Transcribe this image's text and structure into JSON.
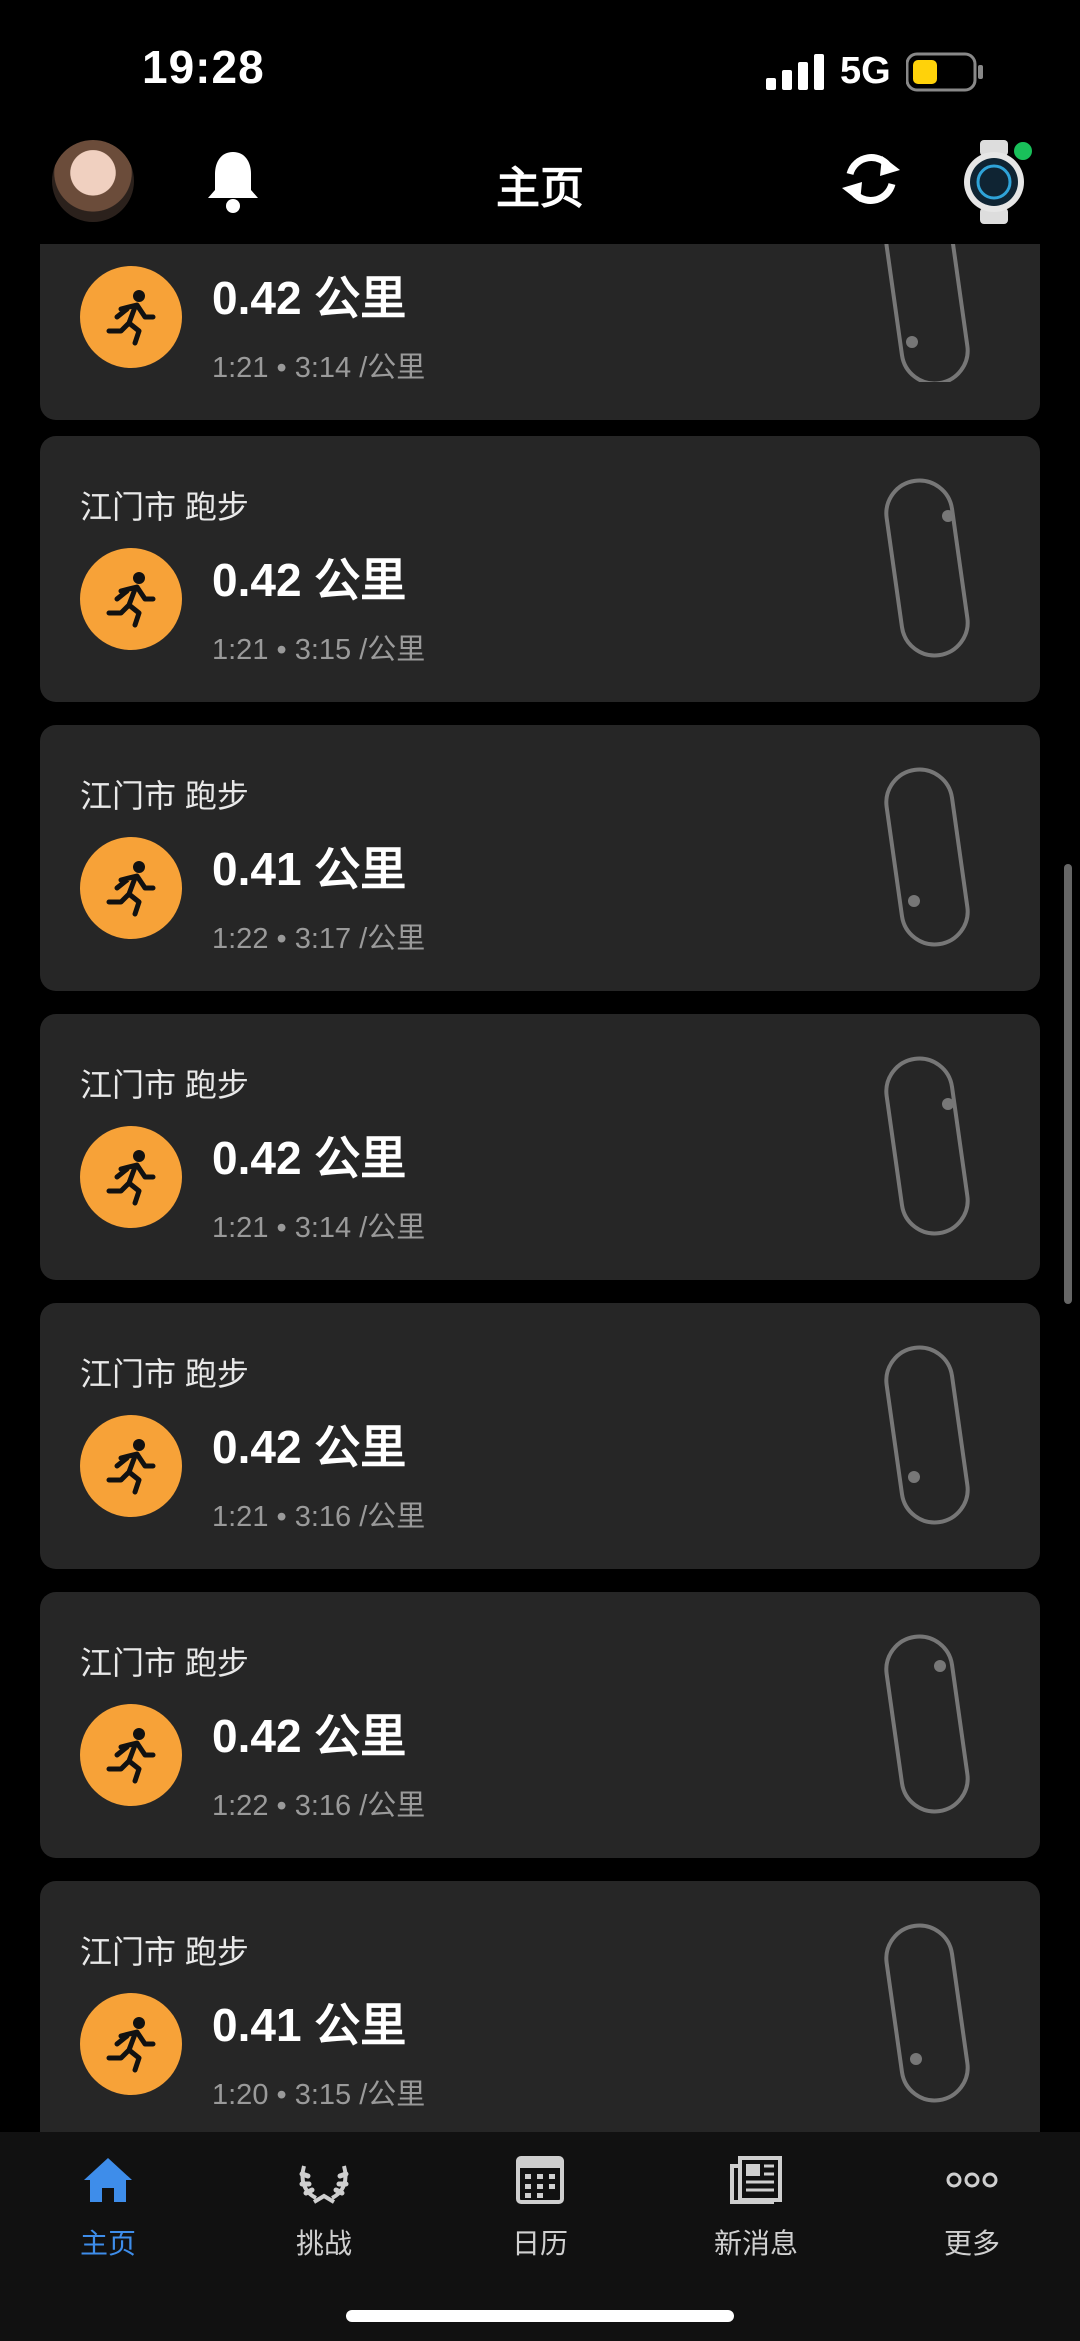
{
  "status": {
    "time": "19:28",
    "network": "5G"
  },
  "header": {
    "title": "主页"
  },
  "activities": [
    {
      "location": "",
      "distance": "0.42 公里",
      "time": "1:21",
      "pace": "3:14 /公里"
    },
    {
      "location": "江门市 跑步",
      "distance": "0.42 公里",
      "time": "1:21",
      "pace": "3:15 /公里"
    },
    {
      "location": "江门市 跑步",
      "distance": "0.41 公里",
      "time": "1:22",
      "pace": "3:17 /公里"
    },
    {
      "location": "江门市 跑步",
      "distance": "0.42 公里",
      "time": "1:21",
      "pace": "3:14 /公里"
    },
    {
      "location": "江门市 跑步",
      "distance": "0.42 公里",
      "time": "1:21",
      "pace": "3:16 /公里"
    },
    {
      "location": "江门市 跑步",
      "distance": "0.42 公里",
      "time": "1:22",
      "pace": "3:16 /公里"
    },
    {
      "location": "江门市 跑步",
      "distance": "0.41 公里",
      "time": "1:20",
      "pace": "3:15 /公里"
    }
  ],
  "tabs": [
    {
      "label": "主页",
      "icon": "home-icon",
      "active": true
    },
    {
      "label": "挑战",
      "icon": "laurel-icon",
      "active": false
    },
    {
      "label": "日历",
      "icon": "calendar-icon",
      "active": false
    },
    {
      "label": "新消息",
      "icon": "news-icon",
      "active": false
    },
    {
      "label": "更多",
      "icon": "more-icon",
      "active": false
    }
  ],
  "colors": {
    "accent": "#3e8dea",
    "activity_icon": "#f7a238",
    "card_bg": "#262626"
  }
}
